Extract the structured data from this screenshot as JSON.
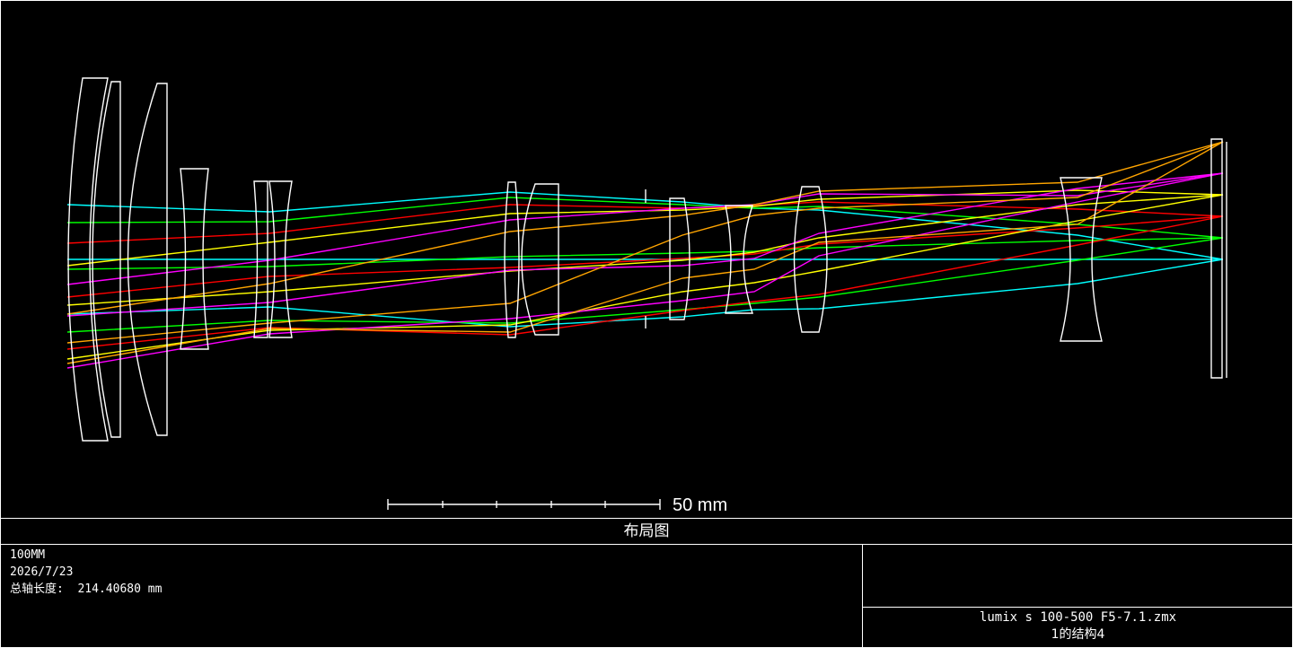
{
  "window_title": "布局图",
  "scale_bar": {
    "label": "50 mm"
  },
  "info": {
    "lens_name": "100MM",
    "date": "2026/7/23",
    "axis_length_label": "总轴长度:",
    "axis_length_value": "214.40680 mm",
    "file_name": "lumix s 100-500 F5-7.1.zmx",
    "configuration": "1的结构4"
  },
  "colors": {
    "background": "#000000",
    "lens_outline": "#ffffff",
    "ray_fields": [
      "#00ffff",
      "#00ff00",
      "#ff0000",
      "#ffff00",
      "#ff00ff",
      "#ffa500"
    ]
  },
  "diagram": {
    "type": "optical-layout",
    "lens_elements": 13,
    "ray_fields": 6,
    "units": "mm"
  }
}
